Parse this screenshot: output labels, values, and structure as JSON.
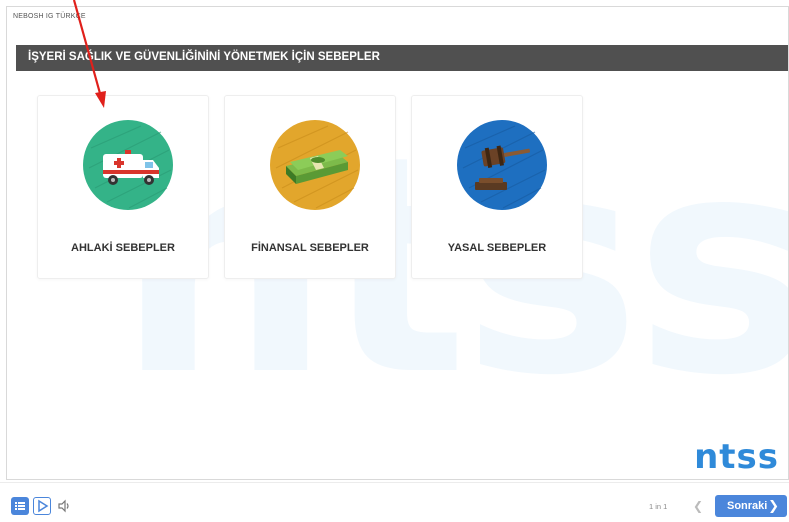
{
  "course": {
    "title": "NEBOSH IG TÜRKÇE"
  },
  "header": {
    "title": "İŞYERİ SAĞLIK VE GÜVENLİĞİNİNİ YÖNETMEK İÇİN SEBEPLER"
  },
  "watermark": {
    "text": "ntss"
  },
  "cards": [
    {
      "label": "AHLAKİ SEBEPLER",
      "icon": "ambulance-icon",
      "color": "#34b388"
    },
    {
      "label": "FİNANSAL SEBEPLER",
      "icon": "money-stack-icon",
      "color": "#e2a62c"
    },
    {
      "label": "YASAL SEBEPLER",
      "icon": "gavel-icon",
      "color": "#1e6fc0"
    }
  ],
  "brand": {
    "logo_text": "ntss",
    "color": "#2f8ad9"
  },
  "footer": {
    "menu_icon": "list-icon",
    "play_icon": "play-icon",
    "volume_icon": "volume-icon",
    "page_indicator": "1 in 1",
    "prev_icon": "chevron-left-icon",
    "next_label": "Sonraki",
    "next_icon": "chevron-right-icon",
    "accent": "#4b86db"
  },
  "annotation": {
    "arrow_color": "#e0201b"
  }
}
